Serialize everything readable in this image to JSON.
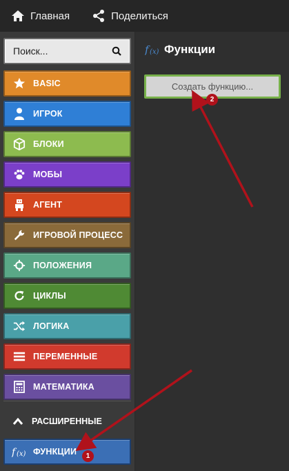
{
  "topbar": {
    "home_label": "Главная",
    "share_label": "Поделиться"
  },
  "search": {
    "placeholder": "Поиск..."
  },
  "categories": [
    {
      "label": "BASIC",
      "color": "#e08a2a",
      "icon": "star-icon"
    },
    {
      "label": "ИГРОК",
      "color": "#2f7fd6",
      "icon": "person-icon"
    },
    {
      "label": "БЛОКИ",
      "color": "#8dbb4f",
      "icon": "cube-icon"
    },
    {
      "label": "МОБЫ",
      "color": "#7b3fc9",
      "icon": "paw-icon"
    },
    {
      "label": "АГЕНТ",
      "color": "#d4471f",
      "icon": "agent-icon"
    },
    {
      "label": "ИГРОВОЙ ПРОЦЕСС",
      "color": "#8a6a3a",
      "icon": "wrench-icon"
    },
    {
      "label": "ПОЛОЖЕНИЯ",
      "color": "#5aa887",
      "icon": "crosshair-icon"
    },
    {
      "label": "ЦИКЛЫ",
      "color": "#4f8a34",
      "icon": "loop-icon"
    },
    {
      "label": "ЛОГИКА",
      "color": "#4aa0a9",
      "icon": "shuffle-icon"
    },
    {
      "label": "ПЕРЕМЕННЫЕ",
      "color": "#d13a2d",
      "icon": "list-icon"
    },
    {
      "label": "МАТЕМАТИКА",
      "color": "#6a4fa0",
      "icon": "calculator-icon"
    }
  ],
  "advanced": {
    "label": "РАСШИРЕННЫЕ",
    "icon": "chevron-up-icon"
  },
  "functions_category": {
    "label": "ФУНКЦИИ",
    "color": "#3b6fb5",
    "icon": "function-icon"
  },
  "panel": {
    "title": "Функции",
    "icon": "function-icon",
    "create_button_label": "Создать функцию..."
  },
  "annotations": {
    "badge_1": "1",
    "badge_2": "2",
    "arrow_color": "#b0121b"
  }
}
